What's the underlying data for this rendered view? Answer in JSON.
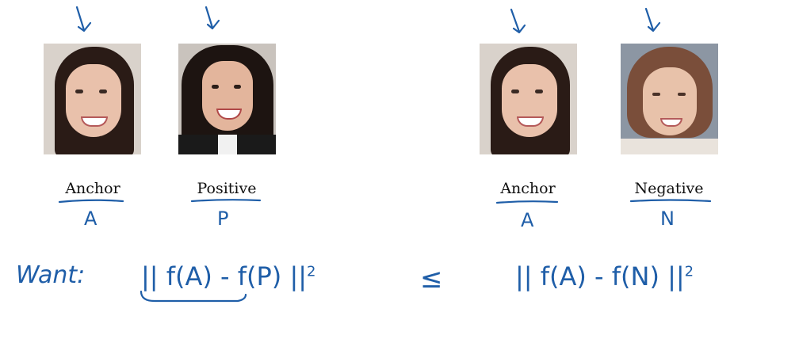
{
  "panels": [
    {
      "label": "Anchor",
      "letter": "A"
    },
    {
      "label": "Positive",
      "letter": "P"
    },
    {
      "label": "Anchor",
      "letter": "A"
    },
    {
      "label": "Negative",
      "letter": "N"
    }
  ],
  "equation": {
    "want": "Want:",
    "lhs": "|| f(A) - f(P) ||",
    "lhs_exp": "2",
    "relation": "≤",
    "rhs": "|| f(A) - f(N) ||",
    "rhs_exp": "2"
  },
  "colors": {
    "ink": "#1f5ea8"
  }
}
